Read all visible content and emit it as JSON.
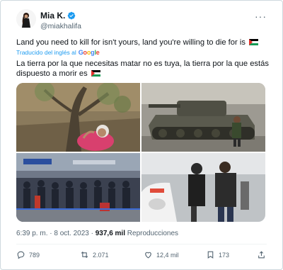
{
  "author": {
    "name": "Mia K.",
    "handle": "@miakhalifa",
    "verified": true
  },
  "tweet": {
    "text_en": "Land you need to kill for isn't yours, land you're willing to die for is",
    "translated_label": "Traducido del inglés al",
    "translator": "Google",
    "text_es": "La tierra por la que necesitas matar no es tuya, la tierra por la que estás dispuesto a morir es",
    "flag_icon": "palestine-flag-icon"
  },
  "media": [
    {
      "icon": "photo-woman-olive-tree"
    },
    {
      "icon": "photo-tank"
    },
    {
      "icon": "photo-airport-crowd"
    },
    {
      "icon": "photo-street-scene"
    }
  ],
  "meta": {
    "time": "6:39 p. m.",
    "date": "8 oct. 2023",
    "views": "937,6 mil",
    "views_label": "Reproducciones"
  },
  "actions": {
    "replies": "789",
    "retweets": "2.071",
    "likes": "12,4 mil",
    "bookmarks": "173"
  },
  "colors": {
    "accent": "#1d9bf0",
    "secondary_text": "#536471",
    "border": "#cfd9de"
  }
}
